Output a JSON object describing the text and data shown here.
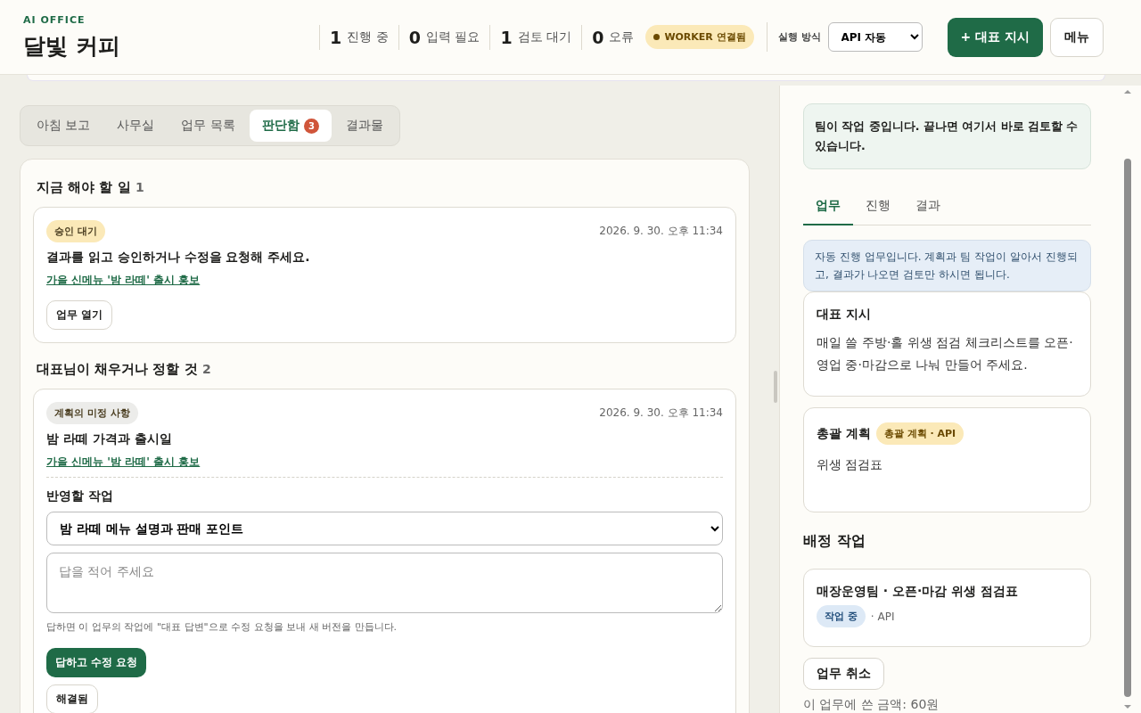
{
  "header": {
    "eyebrow": "AI OFFICE",
    "title": "달빛 커피",
    "stats": [
      {
        "count": "1",
        "label": "진행 중"
      },
      {
        "count": "0",
        "label": "입력 필요"
      },
      {
        "count": "1",
        "label": "검토 대기"
      },
      {
        "count": "0",
        "label": "오류"
      }
    ],
    "worker": {
      "label": "WORKER 연결됨",
      "connected": true
    },
    "mode": {
      "label": "실행 방식",
      "value": "API 자동"
    },
    "primary_button": "+ 대표 지시",
    "menu_button": "메뉴"
  },
  "tabs": [
    {
      "label": "아침 보고",
      "selected": false
    },
    {
      "label": "사무실",
      "selected": false
    },
    {
      "label": "업무 목록",
      "selected": false
    },
    {
      "label": "판단함",
      "selected": true,
      "badge": "3"
    },
    {
      "label": "결과물",
      "selected": false
    }
  ],
  "sections": [
    {
      "title": "지금 해야 할 일",
      "count": "1",
      "items": [
        {
          "kind": "approval",
          "tag": "승인 대기",
          "color": "#fbe9b8",
          "time": "2026. 9. 30. 오후 11:34",
          "title": "결과를 읽고 승인하거나 수정을 요청해 주세요.",
          "link": "가을 신메뉴 '밤 라떼' 출시 홍보",
          "button": "업무 열기"
        }
      ]
    },
    {
      "title": "대표님이 채우거나 정할 것",
      "count": "2",
      "items": [
        {
          "kind": "question",
          "tag": "계획의 미정 사항",
          "color": "#ececea",
          "time": "2026. 9. 30. 오후 11:34",
          "title": "밤 라떼 가격과 출시일",
          "link": "가을 신메뉴 '밤 라떼' 출시 홍보",
          "target_label": "반영할 작업",
          "target_value": "밤 라떼 메뉴 설명과 판매 포인트",
          "placeholder": "답을 적어 주세요",
          "hint": "답하면 이 업무의 작업에 \"대표 답변\"으로 수정 요청을 보내 새 버전을 만듭니다.",
          "button": "답하고 수정 요청",
          "secondary_button": "해결됨"
        }
      ]
    }
  ],
  "side": {
    "notice": "팀이 작업 중입니다. 끝나면 여기서 바로 검토할 수 있습니다.",
    "tabs": [
      {
        "label": "업무",
        "selected": true
      },
      {
        "label": "진행",
        "selected": false
      },
      {
        "label": "결과",
        "selected": false
      }
    ],
    "info": "자동 진행 업무입니다. 계획과 팀 작업이 알아서 진행되고, 결과가 나오면 검토만 하시면 됩니다.",
    "directive": {
      "title": "대표 지시",
      "body": "매일 쓸 주방·홀 위생 점검 체크리스트를 오픈·영업 중·마감으로 나눠 만들어 주세요."
    },
    "plan": {
      "title": "총괄 계획",
      "tag": "총괄 계획 · API",
      "body": "위생 점검표"
    },
    "assigned_title": "배정 작업",
    "assignments": [
      {
        "title": "매장운영팀 · 오픈·마감 위생 점검표",
        "status": "작업 중",
        "via": "· API"
      }
    ],
    "cancel_button": "업무 취소",
    "cost": "이 업무에 쓴 금액: 60원"
  }
}
